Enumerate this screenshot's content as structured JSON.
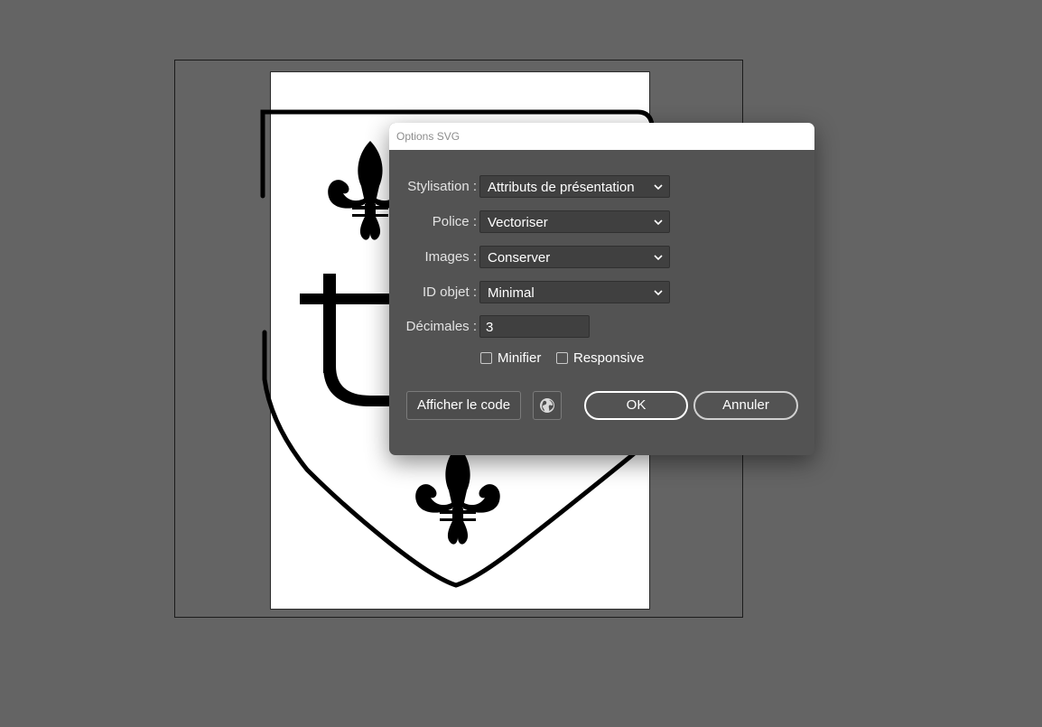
{
  "dialog": {
    "title": "Options SVG",
    "styling": {
      "label": "Stylisation :",
      "value": "Attributs de présentation"
    },
    "font": {
      "label": "Police :",
      "value": "Vectoriser"
    },
    "images": {
      "label": "Images :",
      "value": "Conserver"
    },
    "object_ids": {
      "label": "ID objet :",
      "value": "Minimal"
    },
    "decimals": {
      "label": "Décimales :",
      "value": "3"
    },
    "minify": {
      "label": "Minifier",
      "checked": false
    },
    "responsive": {
      "label": "Responsive",
      "checked": false
    },
    "show_code_label": "Afficher le code",
    "ok_label": "OK",
    "cancel_label": "Annuler",
    "globe_icon": "globe-icon"
  }
}
